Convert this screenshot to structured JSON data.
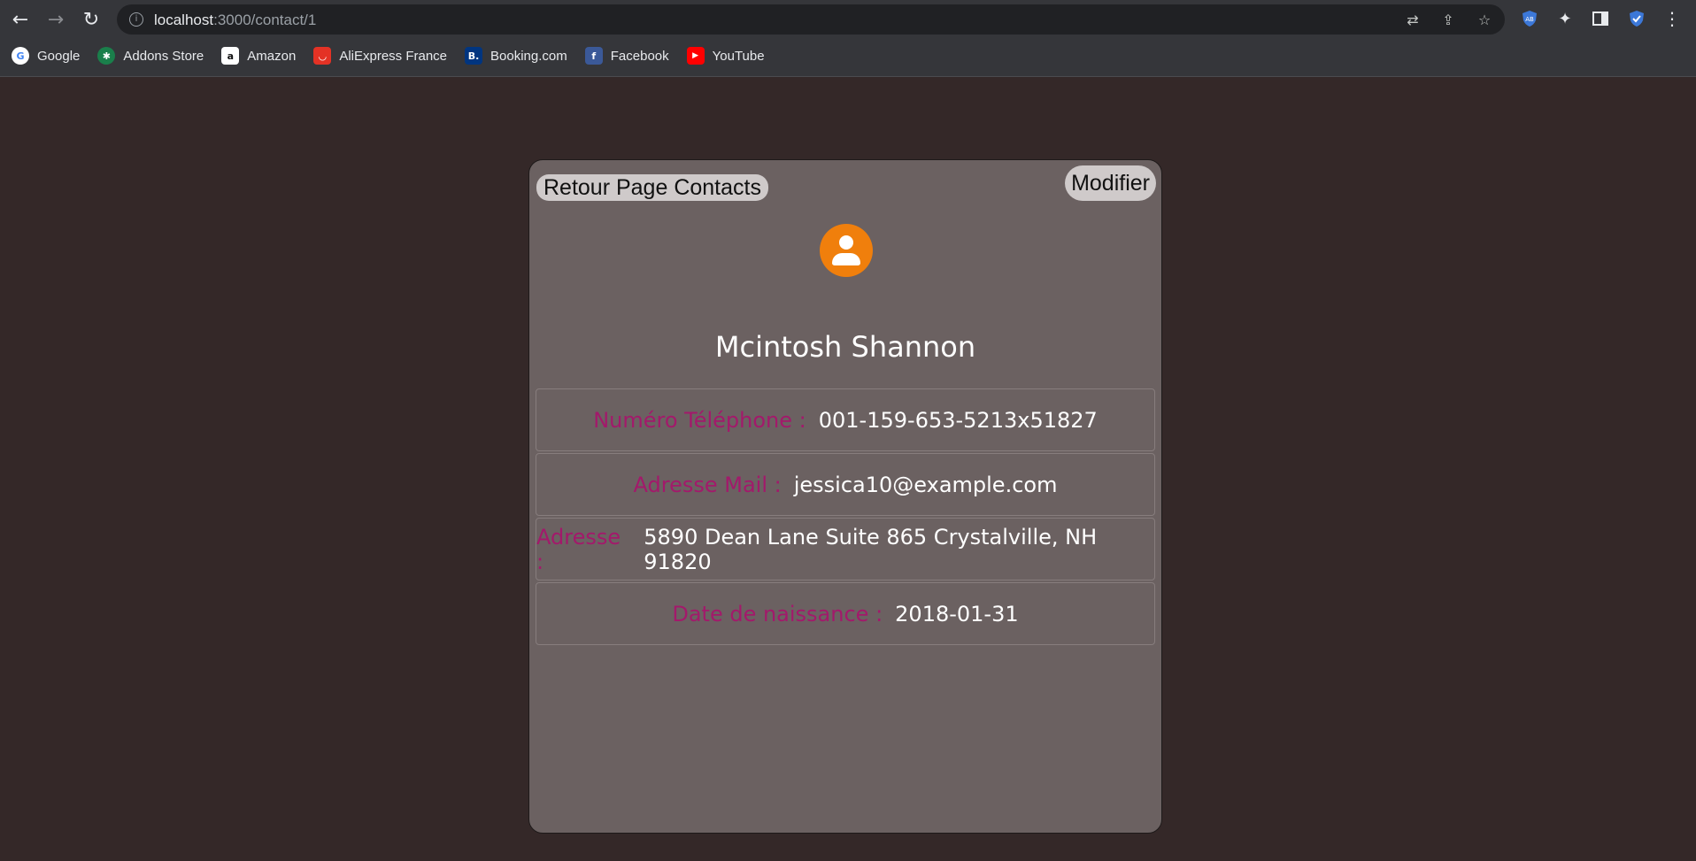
{
  "browser": {
    "url_host": "localhost",
    "url_path": ":3000/contact/1",
    "bookmarks": [
      {
        "label": "Google",
        "icon": "google-icon",
        "color": "#ffffff"
      },
      {
        "label": "Addons Store",
        "icon": "addons-store-icon",
        "color": "#1a7f4b"
      },
      {
        "label": "Amazon",
        "icon": "amazon-icon",
        "color": "#ffffff"
      },
      {
        "label": "AliExpress France",
        "icon": "aliexpress-icon",
        "color": "#e43225"
      },
      {
        "label": "Booking.com",
        "icon": "booking-icon",
        "color": "#003580"
      },
      {
        "label": "Facebook",
        "icon": "facebook-icon",
        "color": "#3b5998"
      },
      {
        "label": "YouTube",
        "icon": "youtube-icon",
        "color": "#ff0000"
      }
    ]
  },
  "contact": {
    "back_label": "Retour Page Contacts",
    "edit_label": "Modifier",
    "name": "Mcintosh Shannon",
    "avatar_color": "#f07f0c",
    "fields": [
      {
        "label": "Numéro Téléphone :",
        "value": "001-159-653-5213x51827"
      },
      {
        "label": "Adresse Mail :",
        "value": "jessica10@example.com"
      },
      {
        "label": "Adresse :",
        "value": "5890 Dean Lane Suite 865 Crystalville, NH 91820"
      },
      {
        "label": "Date de naissance :",
        "value": "2018-01-31"
      }
    ]
  },
  "colors": {
    "page_bg": "#342828",
    "card_bg": "#6b6161",
    "label": "#a3196b"
  }
}
